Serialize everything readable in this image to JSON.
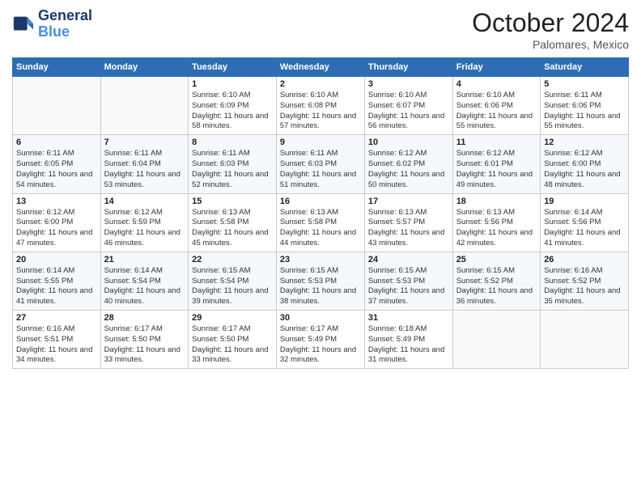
{
  "header": {
    "logo_line1": "General",
    "logo_line2": "Blue",
    "month_title": "October 2024",
    "location": "Palomares, Mexico"
  },
  "weekdays": [
    "Sunday",
    "Monday",
    "Tuesday",
    "Wednesday",
    "Thursday",
    "Friday",
    "Saturday"
  ],
  "weeks": [
    [
      {
        "day": "",
        "info": ""
      },
      {
        "day": "",
        "info": ""
      },
      {
        "day": "1",
        "info": "Sunrise: 6:10 AM\nSunset: 6:09 PM\nDaylight: 11 hours and 58 minutes."
      },
      {
        "day": "2",
        "info": "Sunrise: 6:10 AM\nSunset: 6:08 PM\nDaylight: 11 hours and 57 minutes."
      },
      {
        "day": "3",
        "info": "Sunrise: 6:10 AM\nSunset: 6:07 PM\nDaylight: 11 hours and 56 minutes."
      },
      {
        "day": "4",
        "info": "Sunrise: 6:10 AM\nSunset: 6:06 PM\nDaylight: 11 hours and 55 minutes."
      },
      {
        "day": "5",
        "info": "Sunrise: 6:11 AM\nSunset: 6:06 PM\nDaylight: 11 hours and 55 minutes."
      }
    ],
    [
      {
        "day": "6",
        "info": "Sunrise: 6:11 AM\nSunset: 6:05 PM\nDaylight: 11 hours and 54 minutes."
      },
      {
        "day": "7",
        "info": "Sunrise: 6:11 AM\nSunset: 6:04 PM\nDaylight: 11 hours and 53 minutes."
      },
      {
        "day": "8",
        "info": "Sunrise: 6:11 AM\nSunset: 6:03 PM\nDaylight: 11 hours and 52 minutes."
      },
      {
        "day": "9",
        "info": "Sunrise: 6:11 AM\nSunset: 6:03 PM\nDaylight: 11 hours and 51 minutes."
      },
      {
        "day": "10",
        "info": "Sunrise: 6:12 AM\nSunset: 6:02 PM\nDaylight: 11 hours and 50 minutes."
      },
      {
        "day": "11",
        "info": "Sunrise: 6:12 AM\nSunset: 6:01 PM\nDaylight: 11 hours and 49 minutes."
      },
      {
        "day": "12",
        "info": "Sunrise: 6:12 AM\nSunset: 6:00 PM\nDaylight: 11 hours and 48 minutes."
      }
    ],
    [
      {
        "day": "13",
        "info": "Sunrise: 6:12 AM\nSunset: 6:00 PM\nDaylight: 11 hours and 47 minutes."
      },
      {
        "day": "14",
        "info": "Sunrise: 6:12 AM\nSunset: 5:59 PM\nDaylight: 11 hours and 46 minutes."
      },
      {
        "day": "15",
        "info": "Sunrise: 6:13 AM\nSunset: 5:58 PM\nDaylight: 11 hours and 45 minutes."
      },
      {
        "day": "16",
        "info": "Sunrise: 6:13 AM\nSunset: 5:58 PM\nDaylight: 11 hours and 44 minutes."
      },
      {
        "day": "17",
        "info": "Sunrise: 6:13 AM\nSunset: 5:57 PM\nDaylight: 11 hours and 43 minutes."
      },
      {
        "day": "18",
        "info": "Sunrise: 6:13 AM\nSunset: 5:56 PM\nDaylight: 11 hours and 42 minutes."
      },
      {
        "day": "19",
        "info": "Sunrise: 6:14 AM\nSunset: 5:56 PM\nDaylight: 11 hours and 41 minutes."
      }
    ],
    [
      {
        "day": "20",
        "info": "Sunrise: 6:14 AM\nSunset: 5:55 PM\nDaylight: 11 hours and 41 minutes."
      },
      {
        "day": "21",
        "info": "Sunrise: 6:14 AM\nSunset: 5:54 PM\nDaylight: 11 hours and 40 minutes."
      },
      {
        "day": "22",
        "info": "Sunrise: 6:15 AM\nSunset: 5:54 PM\nDaylight: 11 hours and 39 minutes."
      },
      {
        "day": "23",
        "info": "Sunrise: 6:15 AM\nSunset: 5:53 PM\nDaylight: 11 hours and 38 minutes."
      },
      {
        "day": "24",
        "info": "Sunrise: 6:15 AM\nSunset: 5:53 PM\nDaylight: 11 hours and 37 minutes."
      },
      {
        "day": "25",
        "info": "Sunrise: 6:15 AM\nSunset: 5:52 PM\nDaylight: 11 hours and 36 minutes."
      },
      {
        "day": "26",
        "info": "Sunrise: 6:16 AM\nSunset: 5:52 PM\nDaylight: 11 hours and 35 minutes."
      }
    ],
    [
      {
        "day": "27",
        "info": "Sunrise: 6:16 AM\nSunset: 5:51 PM\nDaylight: 11 hours and 34 minutes."
      },
      {
        "day": "28",
        "info": "Sunrise: 6:17 AM\nSunset: 5:50 PM\nDaylight: 11 hours and 33 minutes."
      },
      {
        "day": "29",
        "info": "Sunrise: 6:17 AM\nSunset: 5:50 PM\nDaylight: 11 hours and 33 minutes."
      },
      {
        "day": "30",
        "info": "Sunrise: 6:17 AM\nSunset: 5:49 PM\nDaylight: 11 hours and 32 minutes."
      },
      {
        "day": "31",
        "info": "Sunrise: 6:18 AM\nSunset: 5:49 PM\nDaylight: 11 hours and 31 minutes."
      },
      {
        "day": "",
        "info": ""
      },
      {
        "day": "",
        "info": ""
      }
    ]
  ]
}
